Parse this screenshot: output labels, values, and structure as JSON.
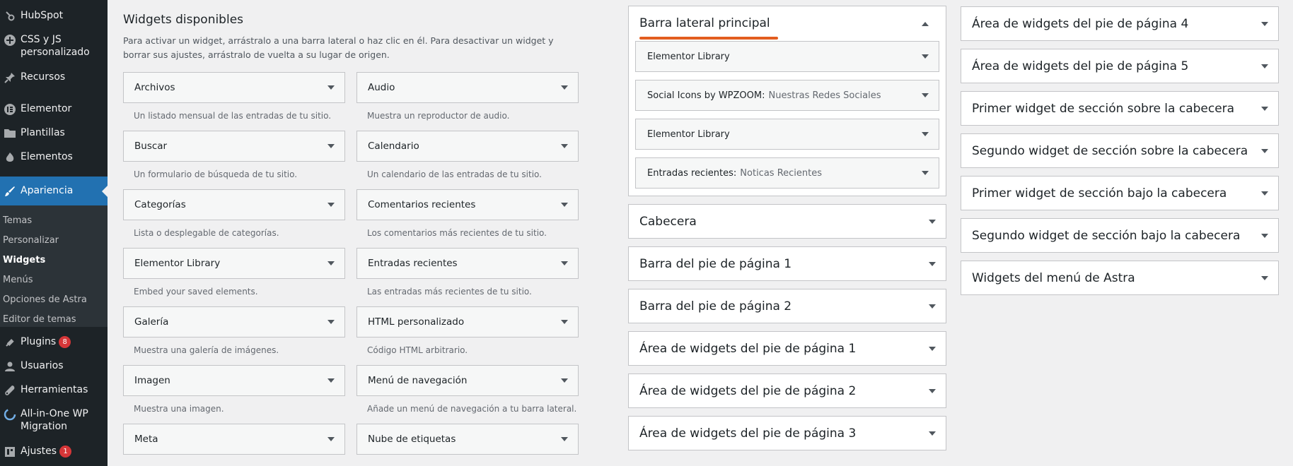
{
  "sidebar": {
    "items": [
      {
        "label": "HubSpot",
        "icon": "hubspot-icon"
      },
      {
        "label": "CSS y JS personalizado",
        "icon": "plus-circle-icon"
      },
      {
        "label": "Recursos",
        "icon": "pin-icon"
      },
      {
        "label": "Elementor",
        "icon": "elementor-icon"
      },
      {
        "label": "Plantillas",
        "icon": "folder-icon"
      },
      {
        "label": "Elementos",
        "icon": "flame-icon"
      },
      {
        "label": "Apariencia",
        "icon": "brush-icon"
      },
      {
        "label": "Plugins",
        "icon": "plug-icon",
        "badge": "8"
      },
      {
        "label": "Usuarios",
        "icon": "user-icon"
      },
      {
        "label": "Herramientas",
        "icon": "wrench-icon"
      },
      {
        "label": "All-in-One WP Migration",
        "icon": "migration-icon"
      },
      {
        "label": "Ajustes",
        "icon": "settings-icon",
        "badge": "1"
      }
    ],
    "submenu": [
      "Temas",
      "Personalizar",
      "Widgets",
      "Menús",
      "Opciones de Astra",
      "Editor de temas"
    ]
  },
  "available": {
    "title": "Widgets disponibles",
    "description": "Para activar un widget, arrástralo a una barra lateral o haz clic en él. Para desactivar un widget y borrar sus ajustes, arrástralo de vuelta a su lugar de origen.",
    "widgets": [
      {
        "name": "Archivos",
        "desc": "Un listado mensual de las entradas de tu sitio."
      },
      {
        "name": "Audio",
        "desc": "Muestra un reproductor de audio."
      },
      {
        "name": "Buscar",
        "desc": "Un formulario de búsqueda de tu sitio."
      },
      {
        "name": "Calendario",
        "desc": "Un calendario de las entradas de tu sitio."
      },
      {
        "name": "Categorías",
        "desc": "Lista o desplegable de categorías."
      },
      {
        "name": "Comentarios recientes",
        "desc": "Los comentarios más recientes de tu sitio."
      },
      {
        "name": "Elementor Library",
        "desc": "Embed your saved elements."
      },
      {
        "name": "Entradas recientes",
        "desc": "Las entradas más recientes de tu sitio."
      },
      {
        "name": "Galería",
        "desc": "Muestra una galería de imágenes."
      },
      {
        "name": "HTML personalizado",
        "desc": "Código HTML arbitrario."
      },
      {
        "name": "Imagen",
        "desc": "Muestra una imagen."
      },
      {
        "name": "Menú de navegación",
        "desc": "Añade un menú de navegación a tu barra lateral."
      },
      {
        "name": "Meta",
        "desc": ""
      },
      {
        "name": "Nube de etiquetas",
        "desc": ""
      }
    ]
  },
  "main_sidebar": {
    "title": "Barra lateral principal",
    "accent": "#e25d1f",
    "widgets": [
      {
        "name": "Elementor Library",
        "subtitle": ""
      },
      {
        "name": "Social Icons by WPZOOM:",
        "subtitle": "Nuestras Redes Sociales"
      },
      {
        "name": "Elementor Library",
        "subtitle": ""
      },
      {
        "name": "Entradas recientes:",
        "subtitle": "Noticas Recientes"
      }
    ]
  },
  "areas_col1": [
    "Cabecera",
    "Barra del pie de página 1",
    "Barra del pie de página 2",
    "Área de widgets del pie de página 1",
    "Área de widgets del pie de página 2",
    "Área de widgets del pie de página 3"
  ],
  "areas_col2": [
    "Área de widgets del pie de página 4",
    "Área de widgets del pie de página 5",
    "Primer widget de sección sobre la cabecera",
    "Segundo widget de sección sobre la cabecera",
    "Primer widget de sección bajo la cabecera",
    "Segundo widget de sección bajo la cabecera",
    "Widgets del menú de Astra"
  ],
  "colors": {
    "sidebar_bg": "#1d2327",
    "active": "#2271b1",
    "badge": "#d63638"
  }
}
